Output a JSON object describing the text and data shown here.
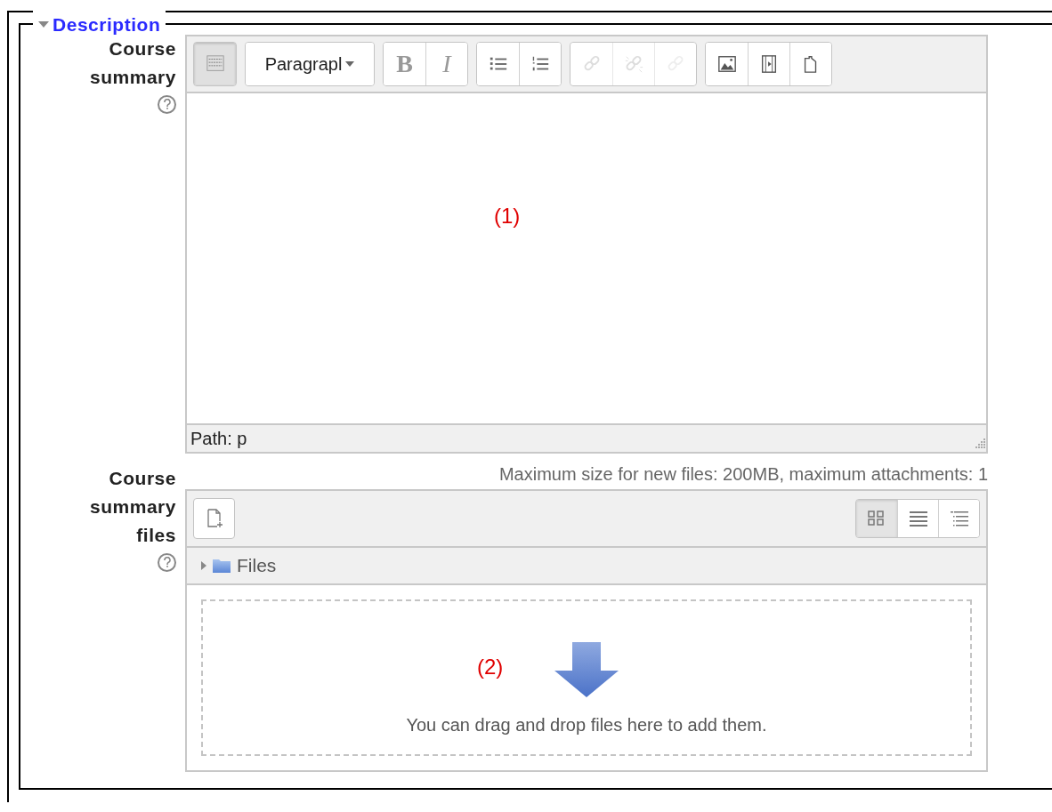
{
  "fieldset": {
    "legend": "Description",
    "expanded": true
  },
  "summary": {
    "label": [
      "Course",
      "summary"
    ],
    "toolbar": [
      [
        {
          "kind": "toggle",
          "on": true,
          "disabled": false
        }
      ],
      [
        {
          "kind": "dropdown",
          "label": "Paragrapl",
          "disabled": false
        }
      ],
      [
        {
          "kind": "bold",
          "label": "B",
          "disabled": false
        },
        {
          "kind": "italic",
          "label": "I",
          "disabled": false
        }
      ],
      [
        {
          "kind": "bullets",
          "disabled": false
        },
        {
          "kind": "numbers",
          "disabled": false
        }
      ],
      [
        {
          "kind": "link",
          "disabled": true
        },
        {
          "kind": "unlink",
          "disabled": true
        },
        {
          "kind": "anchor",
          "disabled": true
        }
      ],
      [
        {
          "kind": "image",
          "disabled": false
        },
        {
          "kind": "media",
          "disabled": false
        },
        {
          "kind": "paste",
          "disabled": false
        }
      ]
    ],
    "annotation": "(1)",
    "path": "Path: p"
  },
  "files": {
    "label": [
      "Course",
      "summary",
      "files"
    ],
    "limits": "Maximum size for new files: 200MB, maximum attachments: 1",
    "views": [
      {
        "kind": "grid",
        "selected": true
      },
      {
        "kind": "list",
        "selected": false
      },
      {
        "kind": "tree",
        "selected": false
      }
    ],
    "folder": {
      "name": "Files",
      "expanded": false
    },
    "annotation": "(2)",
    "dropzone": "You can drag and drop files here to add them."
  }
}
